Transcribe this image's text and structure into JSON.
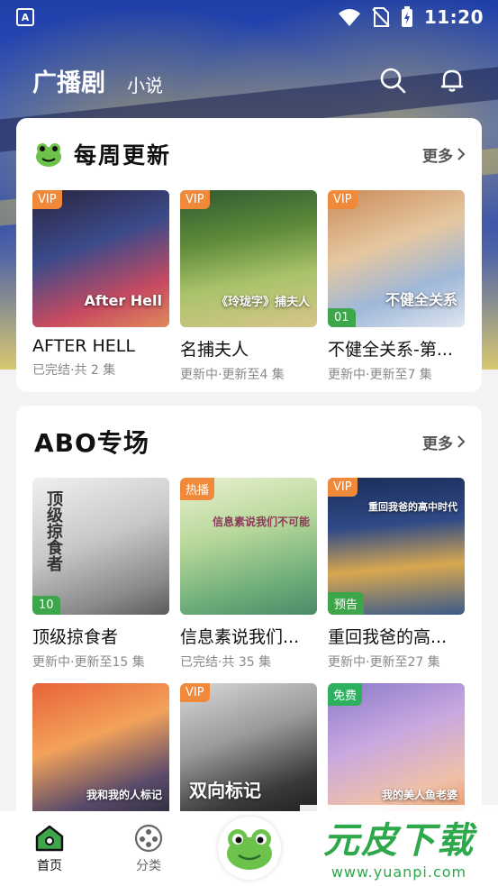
{
  "statusbar": {
    "time": "11:20"
  },
  "header": {
    "title": "广播剧",
    "tab_novel": "小说"
  },
  "weekly": {
    "title": "每周更新",
    "more": "更多",
    "items": [
      {
        "name": "AFTER HELL",
        "status": "已完结·共 2 集",
        "tag": "VIP",
        "cover_text": "After Hell"
      },
      {
        "name": "名捕夫人",
        "status": "更新中·更新至4 集",
        "tag": "VIP",
        "cover_text": "《玲珑字》捕夫人"
      },
      {
        "name": "不健全关系-第...",
        "status": "更新中·更新至7 集",
        "tag": "VIP",
        "episode": "01",
        "cover_text": "不健全关系"
      }
    ]
  },
  "abo": {
    "title": "ABO专场",
    "more": "更多",
    "items": [
      {
        "name": "顶级掠食者",
        "status": "更新中·更新至15 集",
        "episode": "10",
        "cover_text": "顶级掠食者"
      },
      {
        "name": "信息素说我们...",
        "status": "已完结·共 35 集",
        "tag": "热播",
        "cover_text": "信息素说我们不可能"
      },
      {
        "name": "重回我爸的高...",
        "status": "更新中·更新至27 集",
        "tag": "VIP",
        "episode": "预告",
        "cover_text": "重回我爸的高中时代"
      },
      {
        "name": "",
        "status": "",
        "cover_text": "我和我的人标记"
      },
      {
        "name": "",
        "status": "",
        "tag": "VIP",
        "cover_text": "双向标记"
      },
      {
        "name": "",
        "status": "",
        "tag": "免费",
        "cover_text": "我的美人鱼老婆"
      }
    ]
  },
  "tabbar": {
    "home": "首页",
    "category": "分类"
  },
  "watermark": {
    "brand": "元皮下载",
    "url": "www.yuanpi.com"
  },
  "colors": {
    "accent_orange": "#f08a3a",
    "accent_green": "#3ea64a",
    "free_green": "#2db15f",
    "header_blue": "#2b49b5"
  }
}
